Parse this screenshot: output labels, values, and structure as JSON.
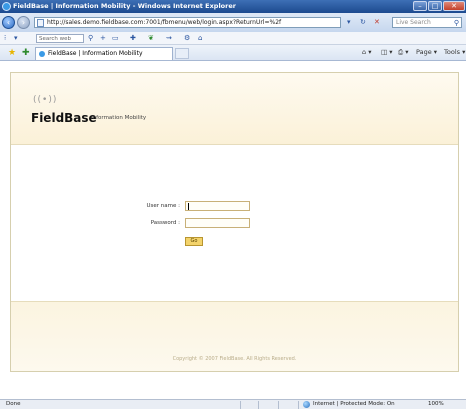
{
  "window": {
    "title": "FieldBase | Information Mobility - Windows Internet Explorer",
    "min_glyph": "–",
    "max_glyph": "□",
    "close_glyph": "✕"
  },
  "addressbar": {
    "url": "http://sales.demo.fieldbase.com:7001/fbmenu/web/login.aspx?ReturnUrl=%2f",
    "refresh_glyph": "↻",
    "stop_glyph": "✕",
    "search_placeholder": "Live Search"
  },
  "toolbar": {
    "search_placeholder": "Search web"
  },
  "tab": {
    "label": "FieldBase | Information Mobility"
  },
  "commands": {
    "page_label": "Page ▾",
    "tools_label": "Tools ▾"
  },
  "page": {
    "brand_part1": "Field",
    "brand_part2": "Base",
    "tagline": "Information Mobility",
    "username_label": "User name :",
    "username_value": "",
    "password_label": "Password :",
    "password_value": "",
    "submit_label": "Go",
    "copyright": "Copyright © 2007 FieldBase. All Rights Reserved."
  },
  "status": {
    "left": "Done",
    "zone": "Internet | Protected Mode: On",
    "zoom": "100%"
  },
  "colors": {
    "header_bg": "#fbf1d8",
    "accent": "#f3d36b",
    "ie_blue": "#1c4a8f"
  }
}
